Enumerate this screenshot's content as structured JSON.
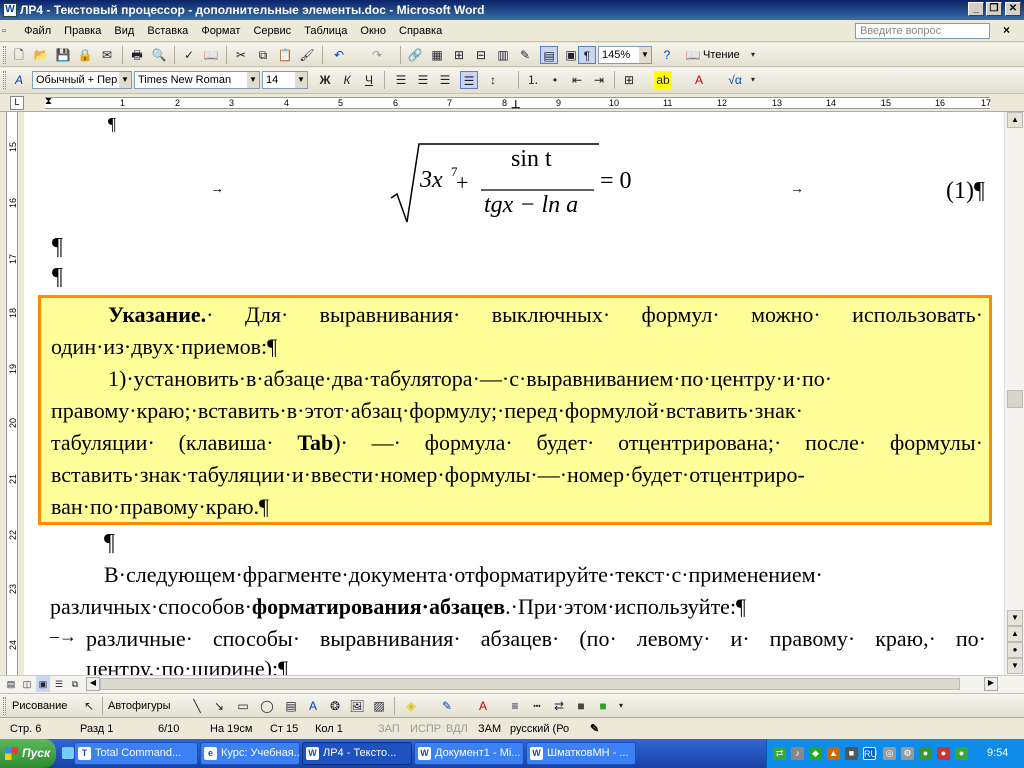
{
  "window": {
    "title": "ЛР4 - Текстовый процессор - дополнительные элементы.doc - Microsoft Word",
    "app_icon": "W"
  },
  "menu": {
    "items": [
      "Файл",
      "Правка",
      "Вид",
      "Вставка",
      "Формат",
      "Сервис",
      "Таблица",
      "Окно",
      "Справка"
    ],
    "help_placeholder": "Введите вопрос",
    "close_doc": "×"
  },
  "toolbar_standard": {
    "zoom": "145%",
    "read_label": "Чтение"
  },
  "toolbar_format": {
    "style": "Обычный + Пер",
    "font": "Times New Roman",
    "size": "14",
    "bold": "Ж",
    "italic": "К",
    "underline": "Ч"
  },
  "ruler": {
    "numbers": [
      "1",
      "2",
      "3",
      "4",
      "5",
      "6",
      "7",
      "8",
      "9",
      "10",
      "11",
      "12",
      "13",
      "14",
      "15",
      "16",
      "17"
    ],
    "vnumbers": [
      "15",
      "16",
      "17",
      "18",
      "19",
      "20",
      "21",
      "22",
      "23",
      "24"
    ]
  },
  "document": {
    "top_mark": "¶",
    "formula": {
      "expr_3x": "3x",
      "exp7": "7",
      "plus": "+",
      "numerator": "sin t",
      "denominator": "tgx − ln a",
      "eq": "= 0",
      "number": "(1)¶",
      "tab_arrow": "→"
    },
    "pilcrow": "¶",
    "note": {
      "line1_bold": "Указание.",
      "line1_rest": "· Для· выравнивания· выключных· формул· можно· использовать·",
      "line2": "один·из·двух·приемов:¶",
      "line3": "1)·установить·в·абзаце·два·табулятора·—·с·выравниванием·по·центру·и·по·",
      "line4": "правому·краю;·вставить·в·этот·абзац·формулу;·перед·формулой·вставить·знак·",
      "line5_a": "табуляции· (клавиша· ",
      "line5_bold": "Tab",
      "line5_b": ")· —· формула· будет· отцентрирована;· после· формулы·",
      "line6": "вставить·знак·табуляции·и·ввести·номер·формулы·—·номер·будет·отцентриро-",
      "line7": "ван·по·правому·краю.¶"
    },
    "after_pilcrow": "¶",
    "para1_line1": "В·следующем·фрагменте·документа·отформатируйте·текст·с·применением·",
    "para1_line2_a": "различных·способов·",
    "para1_line2_bold": "форматирования·абзацев",
    "para1_line2_b": ".·При·этом·используйте:¶",
    "bullet_mark": "–→",
    "bullet1_line1": "различные· способы· выравнивания· абзацев· (по· левому· и· правому· краю,· по·",
    "bullet1_line2": "центру,·по·ширине);¶"
  },
  "draw_toolbar": {
    "drawing": "Рисование",
    "autoshapes": "Автофигуры"
  },
  "status": {
    "page": "Стр. 6",
    "section": "Разд 1",
    "pages": "6/10",
    "at": "На 19см",
    "line": "Ст 15",
    "col": "Кол 1",
    "rec": "ЗАП",
    "trk": "ИСПР",
    "ext": "ВДЛ",
    "ovr": "ЗАМ",
    "lang": "русский (Ро"
  },
  "taskbar": {
    "start": "Пуск",
    "tasks": [
      "Total Command...",
      "Курс: Учебная...",
      "ЛР4 - Тексто...",
      "Документ1 - Mi...",
      "ШматковМН - ..."
    ],
    "lang": "RU",
    "clock": "9:54"
  },
  "colors": {
    "note_bg": "#ffff99",
    "note_border": "#ff8c00",
    "title_bar": "#0a246a",
    "taskbar": "#245edb"
  }
}
